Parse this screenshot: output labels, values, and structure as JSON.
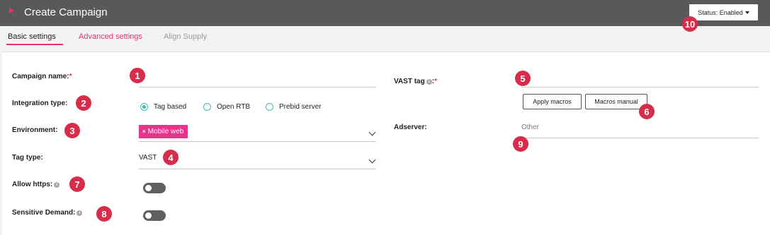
{
  "header": {
    "title": "Create Campaign",
    "status_label": "Status: Enabled",
    "play_icon": "play-triangle-icon",
    "accent_color": "#e8336e",
    "bg_color": "#595959"
  },
  "tabs": [
    {
      "label": "Basic settings",
      "active": true
    },
    {
      "label": "Advanced settings",
      "active": false
    },
    {
      "label": "Align Supply",
      "active": false,
      "disabled": true
    }
  ],
  "form": {
    "campaign_name": {
      "label": "Campaign name:",
      "required_mark": "*",
      "value": ""
    },
    "integration_type": {
      "label": "Integration type:",
      "options": [
        "Tag based",
        "Open RTB",
        "Prebid server"
      ],
      "selected": "Tag based"
    },
    "environment": {
      "label": "Environment:",
      "chips": [
        "Mobile web"
      ],
      "chip_remove_glyph": "×"
    },
    "tag_type": {
      "label": "Tag type:",
      "value": "VAST"
    },
    "allow_https": {
      "label": "Allow https:",
      "enabled": false
    },
    "sensitive_demand": {
      "label": "Sensitive Demand:",
      "enabled": false
    },
    "vast_tag": {
      "label": "VAST tag",
      "suffix": ":",
      "required_mark": "*",
      "value": ""
    },
    "apply_macros_label": "Apply macros",
    "macros_manual_label": "Macros manual",
    "adserver": {
      "label": "Adserver:",
      "value": "Other"
    }
  },
  "badges": [
    "1",
    "2",
    "3",
    "4",
    "5",
    "6",
    "7",
    "8",
    "9",
    "10"
  ],
  "colors": {
    "badge": "#d72c4a",
    "radio": "#3bbfb1",
    "chip": "#e8338a",
    "toggle_off": "#5f5f5f"
  }
}
